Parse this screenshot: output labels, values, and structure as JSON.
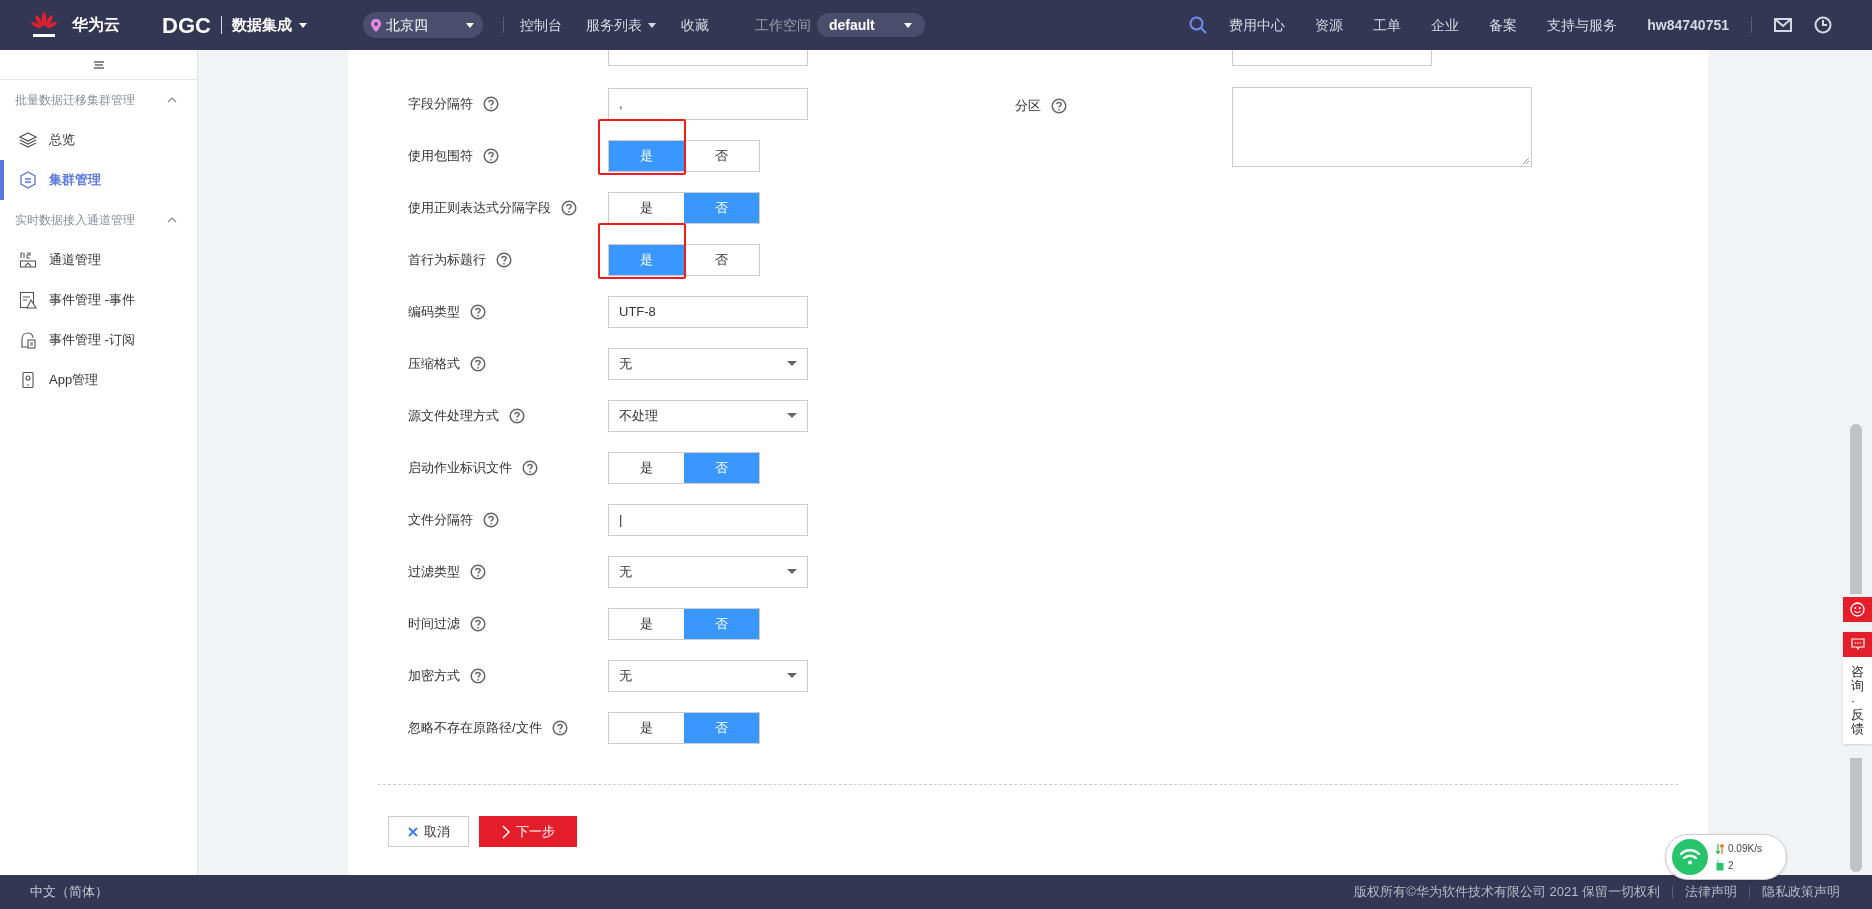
{
  "topbar": {
    "brand": "华为云",
    "product": "DGC",
    "service": "数据集成",
    "region": "北京四",
    "links": [
      {
        "label": "控制台",
        "dropdown": false
      },
      {
        "label": "服务列表",
        "dropdown": true
      },
      {
        "label": "收藏",
        "dropdown": false
      }
    ],
    "workspace_label": "工作空间",
    "workspace": "default",
    "right_links": [
      "费用中心",
      "资源",
      "工单",
      "企业",
      "备案",
      "支持与服务"
    ],
    "user": "hw84740751"
  },
  "sidebar": {
    "groups": [
      {
        "title": "批量数据迁移集群管理",
        "expanded": true,
        "items": [
          {
            "label": "总览",
            "selected": false
          },
          {
            "label": "集群管理",
            "selected": true
          }
        ]
      },
      {
        "title": "实时数据接入通道管理",
        "expanded": true,
        "items": [
          {
            "label": "通道管理",
            "selected": false
          },
          {
            "label": "事件管理 -事件",
            "selected": false
          },
          {
            "label": "事件管理 -订阅",
            "selected": false
          },
          {
            "label": "App管理",
            "selected": false
          }
        ]
      }
    ]
  },
  "form": {
    "left_rows": [
      {
        "kind": "clipped"
      },
      {
        "kind": "input",
        "label": "字段分隔符",
        "value": ","
      },
      {
        "kind": "toggle",
        "label": "使用包围符",
        "highlighted": true,
        "options": [
          {
            "label": "是",
            "selected": true
          },
          {
            "label": "否",
            "selected": false
          }
        ]
      },
      {
        "kind": "toggle",
        "label": "使用正则表达式分隔字段",
        "highlighted": false,
        "options": [
          {
            "label": "是",
            "selected": false
          },
          {
            "label": "否",
            "selected": true
          }
        ]
      },
      {
        "kind": "toggle",
        "label": "首行为标题行",
        "highlighted": true,
        "options": [
          {
            "label": "是",
            "selected": true
          },
          {
            "label": "否",
            "selected": false
          }
        ]
      },
      {
        "kind": "input",
        "label": "编码类型",
        "value": "UTF-8"
      },
      {
        "kind": "select",
        "label": "压缩格式",
        "value": "无"
      },
      {
        "kind": "select",
        "label": "源文件处理方式",
        "value": "不处理"
      },
      {
        "kind": "toggle",
        "label": "启动作业标识文件",
        "highlighted": false,
        "options": [
          {
            "label": "是",
            "selected": false
          },
          {
            "label": "否",
            "selected": true
          }
        ]
      },
      {
        "kind": "input",
        "label": "文件分隔符",
        "value": "|"
      },
      {
        "kind": "select",
        "label": "过滤类型",
        "value": "无"
      },
      {
        "kind": "toggle",
        "label": "时间过滤",
        "highlighted": false,
        "options": [
          {
            "label": "是",
            "selected": false
          },
          {
            "label": "否",
            "selected": true
          }
        ]
      },
      {
        "kind": "select",
        "label": "加密方式",
        "value": "无"
      },
      {
        "kind": "toggle",
        "label": "忽略不存在原路径/文件",
        "highlighted": false,
        "options": [
          {
            "label": "是",
            "selected": false
          },
          {
            "label": "否",
            "selected": true
          }
        ]
      }
    ],
    "right_rows": [
      {
        "kind": "clipped"
      },
      {
        "kind": "textarea",
        "label": "分区"
      }
    ],
    "buttons": [
      {
        "label": "取消",
        "kind": "cancel"
      },
      {
        "label": "下一步",
        "kind": "next"
      }
    ]
  },
  "feedback": {
    "label": "咨询·反馈"
  },
  "network_widget": {
    "speed": "0.09K/s",
    "count": "2"
  },
  "footer": {
    "language": "中文（简体）",
    "copyright": "版权所有©华为软件技术有限公司 2021 保留一切权利",
    "links": [
      "法律声明",
      "隐私政策声明"
    ]
  }
}
